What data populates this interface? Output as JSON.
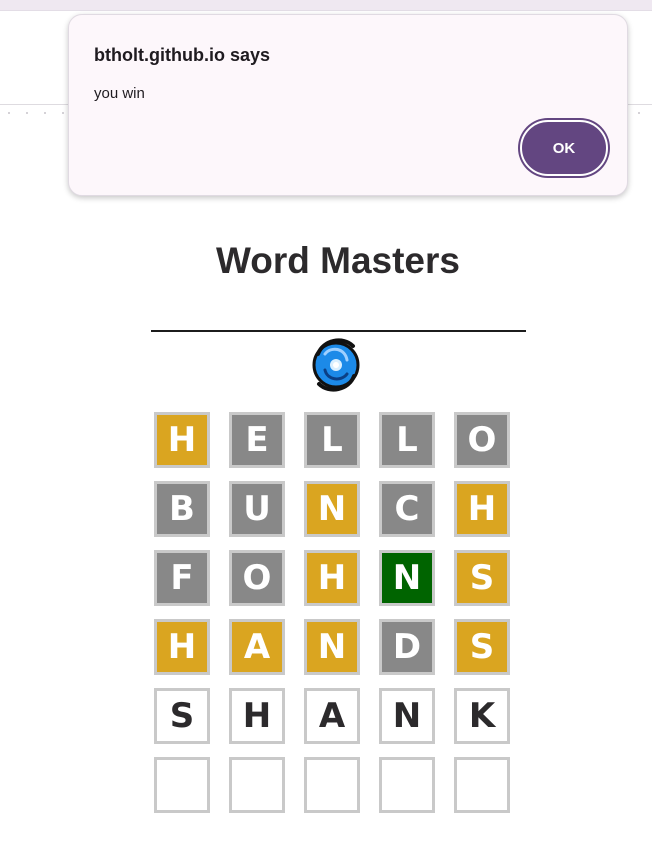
{
  "dialog": {
    "title": "btholt.github.io says",
    "message": "you win",
    "ok_label": "OK"
  },
  "game": {
    "title": "Word Masters",
    "colors": {
      "correct": "#006400",
      "close": "#daa520",
      "wrong": "#888888",
      "empty": "#ffffff"
    },
    "board": [
      [
        {
          "letter": "H",
          "state": "close"
        },
        {
          "letter": "E",
          "state": "wrong"
        },
        {
          "letter": "L",
          "state": "wrong"
        },
        {
          "letter": "L",
          "state": "wrong"
        },
        {
          "letter": "O",
          "state": "wrong"
        }
      ],
      [
        {
          "letter": "B",
          "state": "wrong"
        },
        {
          "letter": "U",
          "state": "wrong"
        },
        {
          "letter": "N",
          "state": "close"
        },
        {
          "letter": "C",
          "state": "wrong"
        },
        {
          "letter": "H",
          "state": "close"
        }
      ],
      [
        {
          "letter": "F",
          "state": "wrong"
        },
        {
          "letter": "O",
          "state": "wrong"
        },
        {
          "letter": "H",
          "state": "close"
        },
        {
          "letter": "N",
          "state": "correct"
        },
        {
          "letter": "S",
          "state": "close"
        }
      ],
      [
        {
          "letter": "H",
          "state": "close"
        },
        {
          "letter": "A",
          "state": "close"
        },
        {
          "letter": "N",
          "state": "close"
        },
        {
          "letter": "D",
          "state": "wrong"
        },
        {
          "letter": "S",
          "state": "close"
        }
      ],
      [
        {
          "letter": "S",
          "state": "empty"
        },
        {
          "letter": "H",
          "state": "empty"
        },
        {
          "letter": "A",
          "state": "empty"
        },
        {
          "letter": "N",
          "state": "empty"
        },
        {
          "letter": "K",
          "state": "empty"
        }
      ],
      [
        {
          "letter": "",
          "state": "empty"
        },
        {
          "letter": "",
          "state": "empty"
        },
        {
          "letter": "",
          "state": "empty"
        },
        {
          "letter": "",
          "state": "empty"
        },
        {
          "letter": "",
          "state": "empty"
        }
      ]
    ]
  }
}
